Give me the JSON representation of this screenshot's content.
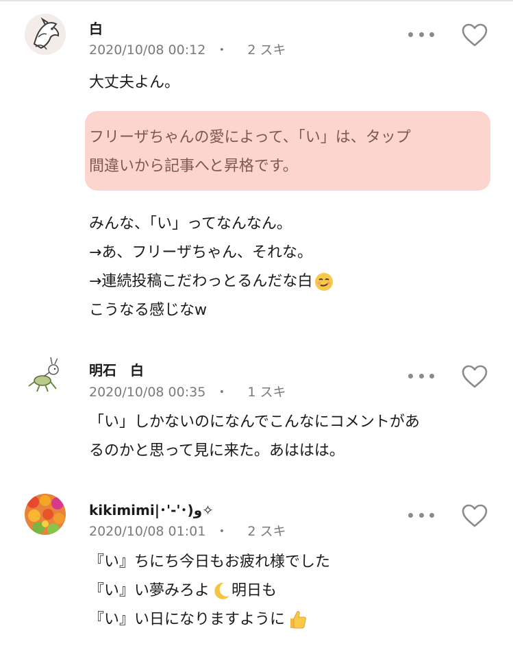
{
  "comments": [
    {
      "author": "白",
      "date": "2020/10/08 00:12",
      "separator": "・",
      "likes": "2 スキ",
      "body": {
        "line1": "大丈夫よん。",
        "highlight": [
          "フリーザちゃんの愛によって、「い」は、タップ",
          "間違いから記事へと昇格です。"
        ],
        "lines": [
          "みんな、「い」ってなんなん。",
          "→あ、フリーザちゃん、それな。",
          "→連続投稿こだわっとるんだな白",
          "こうなる感じなw"
        ]
      }
    },
    {
      "author": "明石　白",
      "date": "2020/10/08 00:35",
      "separator": "・",
      "likes": "1 スキ",
      "body": {
        "lines": [
          "「い」しかないのになんでこんなにコメントがあ",
          "るのかと思って見に来た。あははは。"
        ]
      }
    },
    {
      "author": "kikimimi|･'-'･)و✧",
      "date": "2020/10/08 01:01",
      "separator": "・",
      "likes": "2 スキ",
      "body": {
        "lines": [
          "『い』ちにち今日もお疲れ様でした",
          "『い』い夢みろよ",
          "明日も",
          "『い』い日になりますように"
        ]
      }
    }
  ],
  "icons": {
    "more": "more-dots-icon",
    "like": "heart-outline-icon",
    "emoji_smirk": "smirk-emoji-icon",
    "emoji_moon": "crescent-moon-emoji-icon",
    "emoji_thumb": "thumbs-up-emoji-icon"
  },
  "colors": {
    "highlight": "#f69182",
    "meta": "#7a7a7a",
    "icon": "#8a8a8a"
  }
}
